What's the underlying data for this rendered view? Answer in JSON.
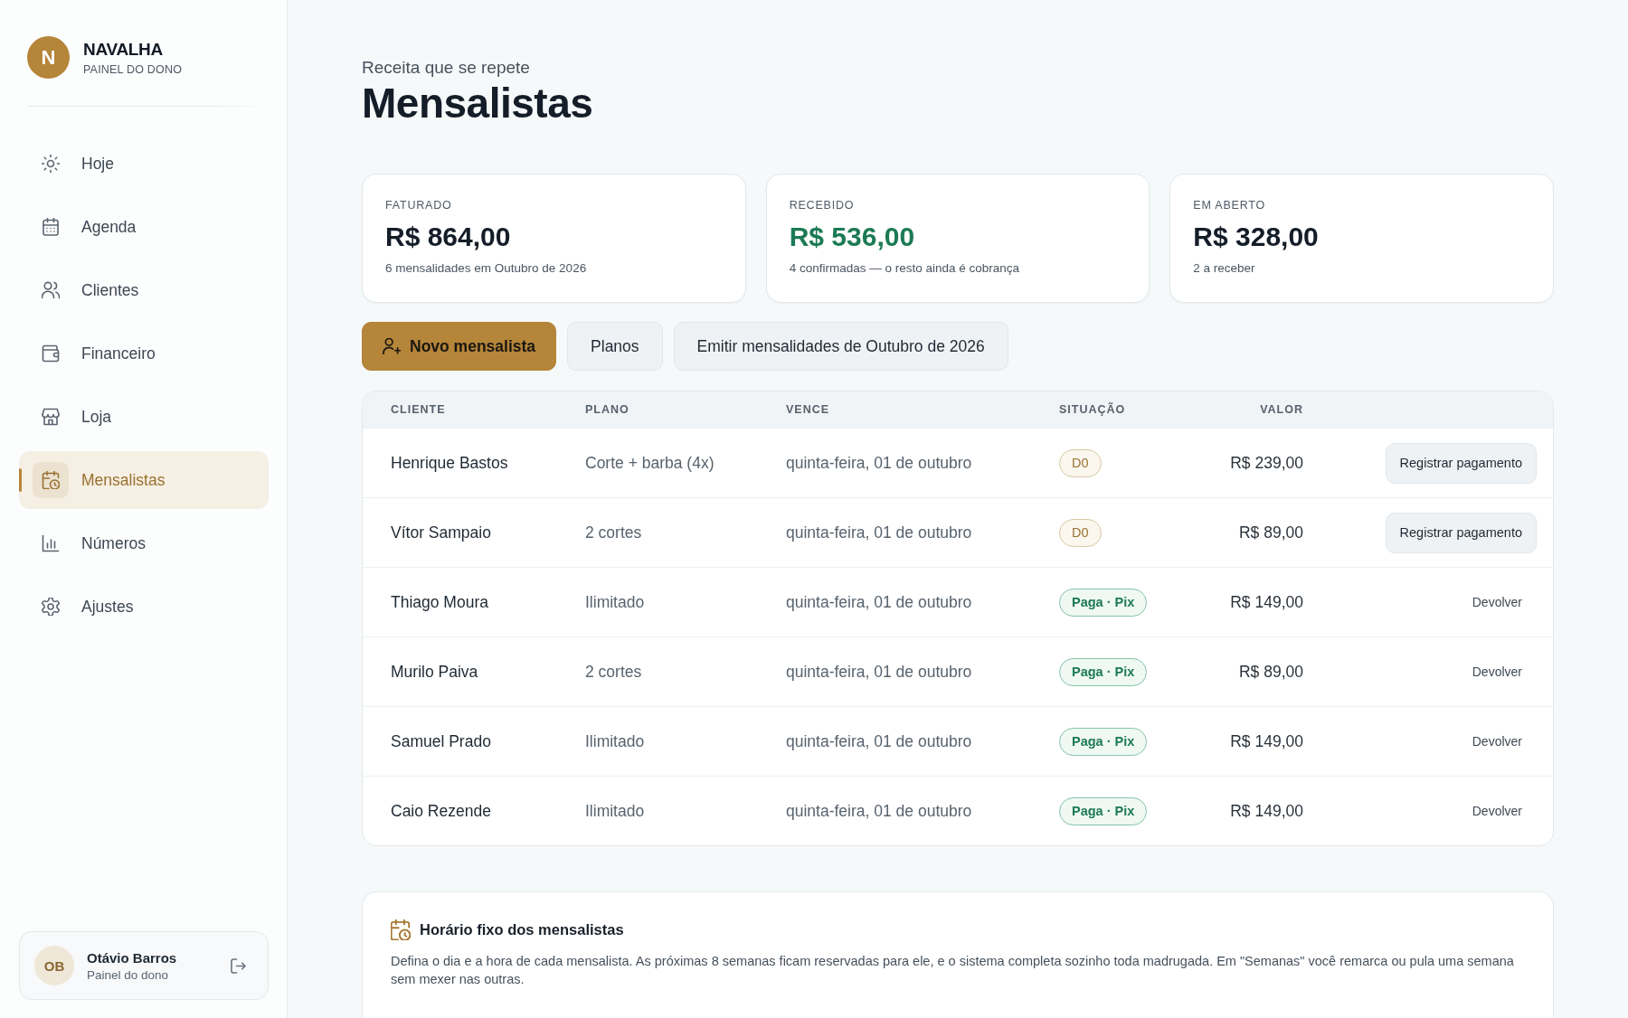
{
  "sidebar": {
    "brand": {
      "initial": "N",
      "name": "NAVALHA",
      "subtitle": "PAINEL DO DONO"
    },
    "nav": [
      {
        "label": "Hoje",
        "selected": false
      },
      {
        "label": "Agenda",
        "selected": false
      },
      {
        "label": "Clientes",
        "selected": false
      },
      {
        "label": "Financeiro",
        "selected": false
      },
      {
        "label": "Loja",
        "selected": false
      },
      {
        "label": "Mensalistas",
        "selected": true
      },
      {
        "label": "Números",
        "selected": false
      },
      {
        "label": "Ajustes",
        "selected": false
      }
    ],
    "user": {
      "initials": "OB",
      "name": "Otávio Barros",
      "role": "Painel do dono"
    }
  },
  "header": {
    "eyebrow": "Receita que se repete",
    "title": "Mensalistas"
  },
  "stats": [
    {
      "label": "FATURADO",
      "value": "R$ 864,00",
      "note": "6 mensalidades em Outubro de 2026",
      "kind": "neutral"
    },
    {
      "label": "RECEBIDO",
      "value": "R$ 536,00",
      "note": "4 confirmadas — o resto ainda é cobrança",
      "kind": "positive"
    },
    {
      "label": "EM ABERTO",
      "value": "R$ 328,00",
      "note": "2 a receber",
      "kind": "neutral"
    }
  ],
  "actions": [
    {
      "label": "Novo mensalista",
      "kind": "primary"
    },
    {
      "label": "Planos",
      "kind": "secondary"
    },
    {
      "label": "Emitir mensalidades de Outubro de 2026",
      "kind": "secondary"
    }
  ],
  "table": {
    "columns": [
      "CLIENTE",
      "PLANO",
      "VENCE",
      "SITUAÇÃO",
      "VALOR"
    ],
    "rows": [
      {
        "client": "Henrique Bastos",
        "plan": "Corte + barba (4x)",
        "due": "quinta-feira, 01 de outubro",
        "status": {
          "label": "D0",
          "kind": "pending"
        },
        "amount": "R$ 239,00",
        "action": {
          "label": "Registrar pagamento",
          "kind": "button"
        }
      },
      {
        "client": "Vítor Sampaio",
        "plan": "2 cortes",
        "due": "quinta-feira, 01 de outubro",
        "status": {
          "label": "D0",
          "kind": "pending"
        },
        "amount": "R$ 89,00",
        "action": {
          "label": "Registrar pagamento",
          "kind": "button"
        }
      },
      {
        "client": "Thiago Moura",
        "plan": "Ilimitado",
        "due": "quinta-feira, 01 de outubro",
        "status": {
          "label": "Paga · Pix",
          "kind": "paid"
        },
        "amount": "R$ 149,00",
        "action": {
          "label": "Devolver",
          "kind": "link"
        }
      },
      {
        "client": "Murilo Paiva",
        "plan": "2 cortes",
        "due": "quinta-feira, 01 de outubro",
        "status": {
          "label": "Paga · Pix",
          "kind": "paid"
        },
        "amount": "R$ 89,00",
        "action": {
          "label": "Devolver",
          "kind": "link"
        }
      },
      {
        "client": "Samuel Prado",
        "plan": "Ilimitado",
        "due": "quinta-feira, 01 de outubro",
        "status": {
          "label": "Paga · Pix",
          "kind": "paid"
        },
        "amount": "R$ 149,00",
        "action": {
          "label": "Devolver",
          "kind": "link"
        }
      },
      {
        "client": "Caio Rezende",
        "plan": "Ilimitado",
        "due": "quinta-feira, 01 de outubro",
        "status": {
          "label": "Paga · Pix",
          "kind": "paid"
        },
        "amount": "R$ 149,00",
        "action": {
          "label": "Devolver",
          "kind": "link"
        }
      }
    ]
  },
  "fixed_schedule": {
    "title": "Horário fixo dos mensalistas",
    "description": "Defina o dia e a hora de cada mensalista. As próximas 8 semanas ficam reservadas para ele, e o sistema completa sozinho toda madrugada. Em \"Semanas\" você remarca ou pula uma semana sem mexer nas outras."
  }
}
